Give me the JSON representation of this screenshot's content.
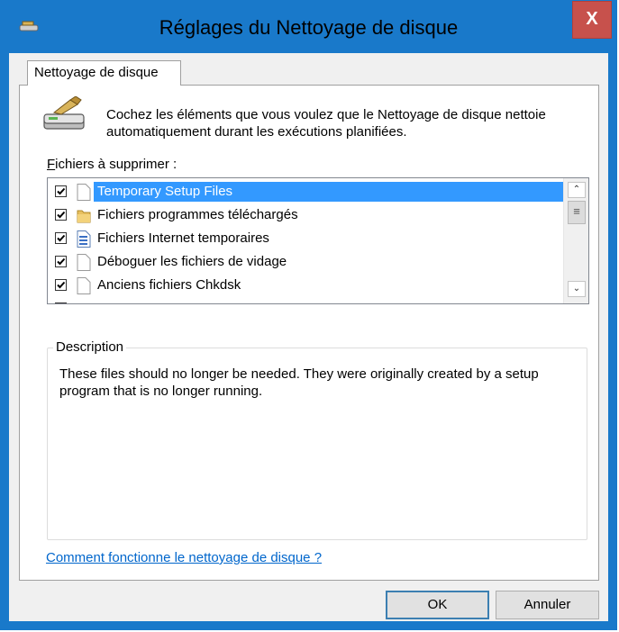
{
  "window": {
    "title": "Réglages du Nettoyage de disque",
    "close_label": "X"
  },
  "tab": {
    "label": "Nettoyage de disque"
  },
  "intro": {
    "text": "Cochez les éléments que vous voulez que le Nettoyage de disque nettoie automatiquement durant les exécutions planifiées."
  },
  "files": {
    "label_accesskey": "F",
    "label_rest": "ichiers à supprimer :",
    "items": [
      {
        "label": "Temporary Setup Files",
        "checked": true,
        "selected": true,
        "icon": "blank-file-icon"
      },
      {
        "label": "Fichiers programmes téléchargés",
        "checked": true,
        "selected": false,
        "icon": "folder-icon"
      },
      {
        "label": "Fichiers Internet temporaires",
        "checked": true,
        "selected": false,
        "icon": "document-icon"
      },
      {
        "label": "Déboguer les fichiers de vidage",
        "checked": true,
        "selected": false,
        "icon": "blank-file-icon"
      },
      {
        "label": "Anciens fichiers Chkdsk",
        "checked": true,
        "selected": false,
        "icon": "blank-file-icon"
      }
    ]
  },
  "description": {
    "legend": "Description",
    "text": "These files should no longer be needed. They were originally created by a setup program that is no longer running."
  },
  "help_link": "Comment fonctionne le nettoyage de disque ?",
  "buttons": {
    "ok": "OK",
    "cancel": "Annuler"
  },
  "colors": {
    "titlebar": "#1979ca",
    "close": "#c7514c",
    "selection": "#3399ff",
    "link": "#0066cc"
  }
}
